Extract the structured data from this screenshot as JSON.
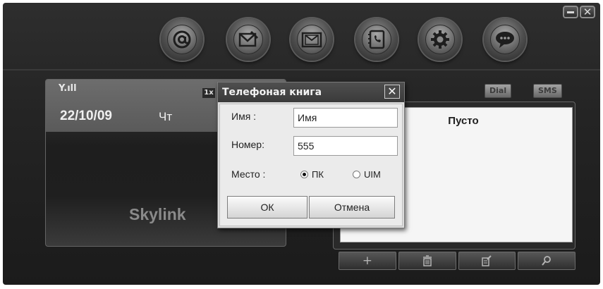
{
  "toolbar": {
    "icons": [
      "email-icon",
      "compose-message-icon",
      "inbox-icon",
      "phonebook-icon",
      "settings-gear-icon",
      "chat-bubble-icon"
    ]
  },
  "window_controls": {
    "minimize": "–",
    "close": "✕"
  },
  "phone_panel": {
    "signal": "Y.ıll",
    "date": "22/10/09",
    "day": "Чт",
    "badge": "1x",
    "brand": "Skylink"
  },
  "contacts_panel": {
    "dial_label": "Dial",
    "sms_label": "SMS",
    "empty_text": "Пусто",
    "tools": [
      "add-icon",
      "delete-icon",
      "edit-icon",
      "search-icon"
    ],
    "add_label": "+"
  },
  "dialog": {
    "title": "Телефоная книга",
    "close": "✕",
    "name_label": "Имя :",
    "name_value": "Имя",
    "number_label": "Номер:",
    "number_value": "555",
    "location_label": "Место :",
    "options": [
      {
        "label": "ПК",
        "selected": true
      },
      {
        "label": "UIM",
        "selected": false
      }
    ],
    "ok_label": "ОК",
    "cancel_label": "Отмена"
  }
}
